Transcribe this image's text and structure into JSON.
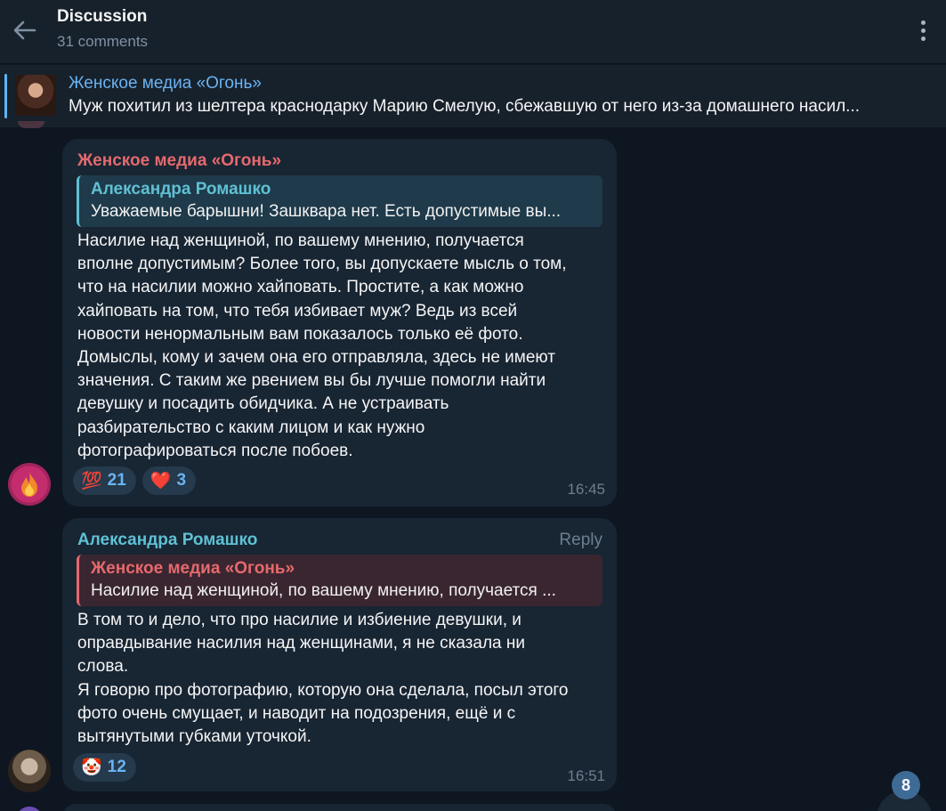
{
  "header": {
    "title": "Discussion",
    "subtitle": "31 comments"
  },
  "pinned": {
    "channel": "Женское медиа «Огонь»",
    "text": "Муж похитил из шелтера краснодарку Марию Смелую, сбежавшую от него из-за домашнего насил..."
  },
  "messages": [
    {
      "author": "Женское медиа «Огонь»",
      "author_color": "#e5696d",
      "quote": {
        "author": "Александра Ромашко",
        "text": "Уважаемые барышни! Зашквара нет. Есть допустимые вы...",
        "color": "#5fc1d4",
        "bg": "#1f3a4a"
      },
      "body": "Насилие над женщиной, по вашему мнению, получается\nвполне допустимым? Более того, вы допускаете мысль о том,\nчто на насилии можно хайповать. Простите, а как можно\nхайповать на том, что тебя избивает муж? Ведь из всей\nновости ненормальным вам показалось только её фото.\nДомыслы, кому и зачем она его отправляла, здесь не имеют\nзначения. С таким же рвением вы бы лучше помогли найти\nдевушку и посадить обидчика. А не устраивать\nразбирательство с каким лицом и как нужно\nфотографироваться после побоев.",
      "reactions": [
        {
          "emoji": "💯",
          "count": "21"
        },
        {
          "emoji": "❤️",
          "count": "3"
        }
      ],
      "time": "16:45",
      "avatar_icon": "fire-avatar"
    },
    {
      "author": "Александра Ромашко",
      "author_color": "#5fc1d4",
      "reply_label": "Reply",
      "quote": {
        "author": "Женское медиа «Огонь»",
        "text": "Насилие над женщиной, по вашему мнению, получается ...",
        "color": "#e5696d",
        "bg": "#3a2630"
      },
      "body": "В том то и дело, что про насилие и избиение девушки, и\nоправдывание насилия над женщинами, я не сказала ни\nслова.\nЯ говорю про фотографию, которую она сделала, посыл этого\nфото очень смущает, и наводит на подозрения, ещё и с\nвытянутыми губками уточкой.",
      "reactions": [
        {
          "emoji": "🤡",
          "count": "12"
        }
      ],
      "time": "16:51",
      "avatar_icon": "photo-avatar"
    }
  ],
  "scroll_badge": "8"
}
